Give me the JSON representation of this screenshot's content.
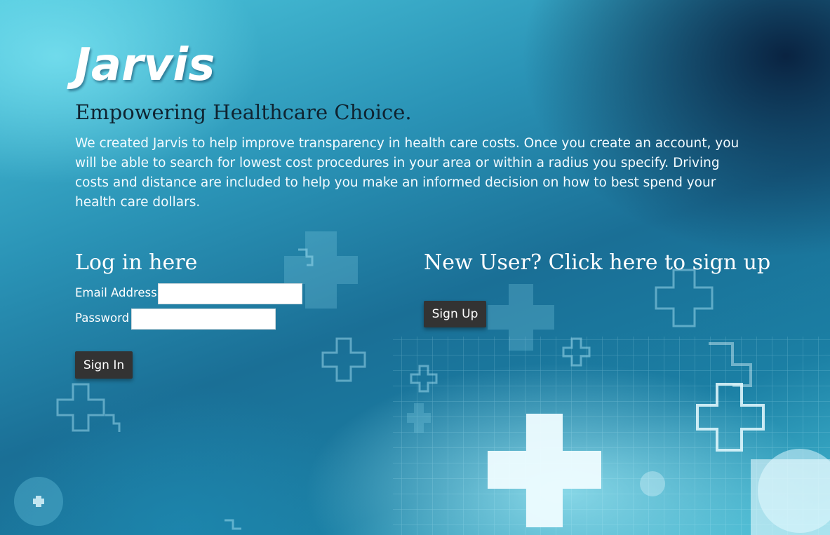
{
  "brand": {
    "logo_text": "Jarvis"
  },
  "hero": {
    "tagline": "Empowering Healthcare Choice.",
    "intro": "We created Jarvis to help improve transparency in health care costs. Once you create an account, you will be able to search for lowest cost procedures in your area or within a radius you specify. Driving costs and distance are included to help you make an informed decision on how to best spend your health care dollars."
  },
  "login": {
    "title": "Log in here",
    "email_label": "Email Address",
    "email_value": "",
    "password_label": "Password",
    "password_value": "",
    "submit_label": "Sign In"
  },
  "signup": {
    "title": "New User? Click here to sign up",
    "button_label": "Sign Up"
  },
  "colors": {
    "button_bg": "#333333",
    "background_accent": "#2a93b6",
    "tagline_text": "#0f2330"
  },
  "background_icon": "medical-cross-icon"
}
